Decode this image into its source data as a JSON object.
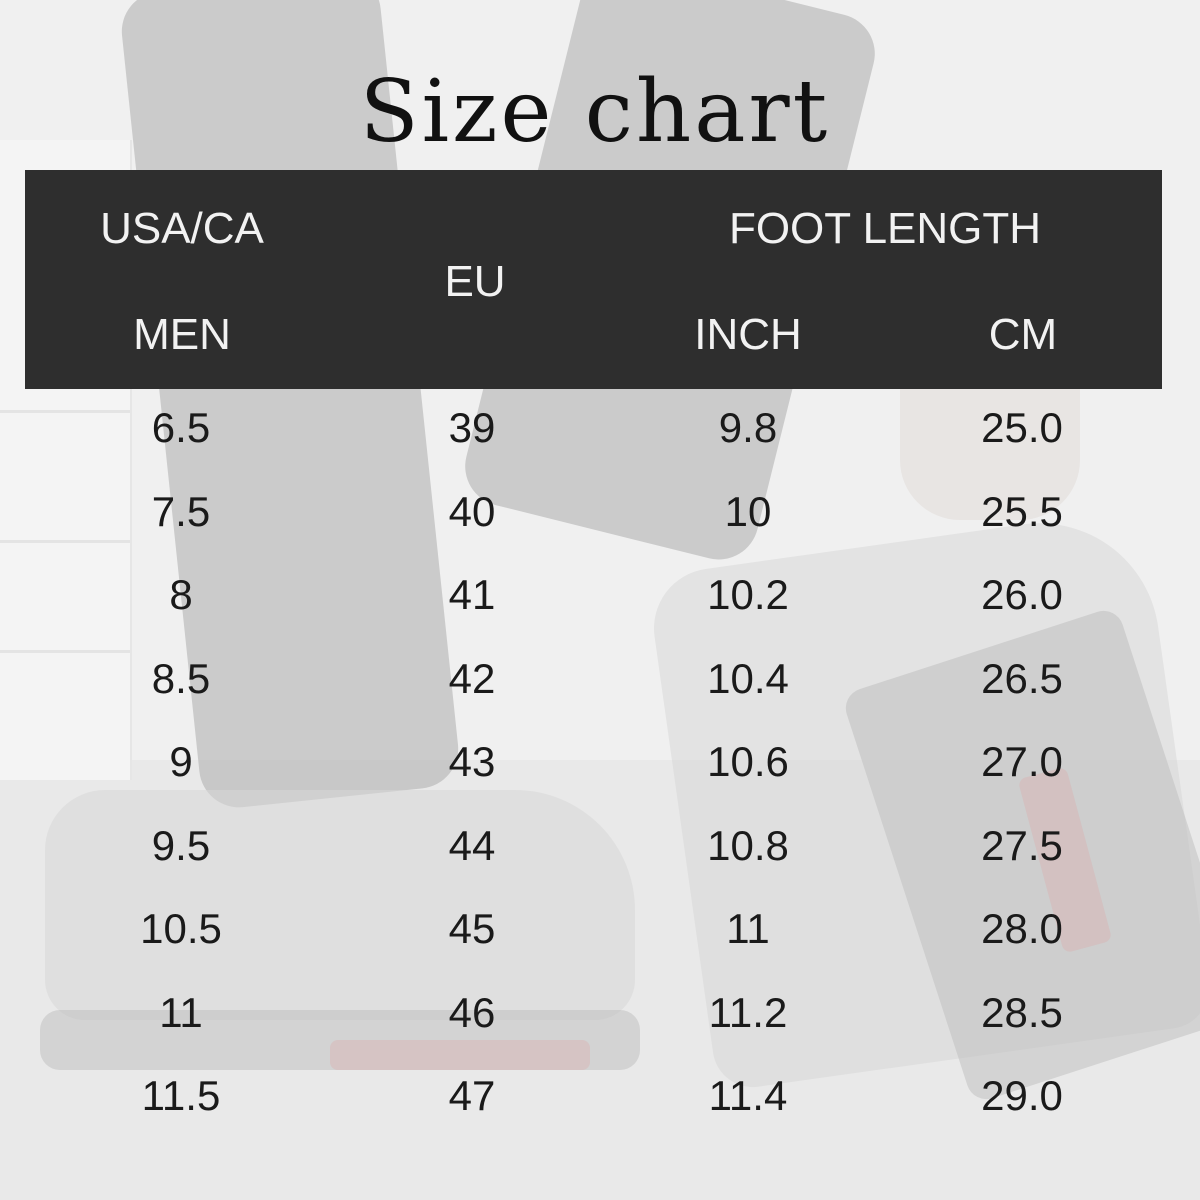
{
  "title": "Size chart",
  "header": {
    "col1_top": "USA/CA",
    "col1_bottom": "MEN",
    "col2": "EU",
    "group_label": "FOOT LENGTH",
    "col3": "INCH",
    "col4": "CM"
  },
  "rows": [
    {
      "men": "6.5",
      "eu": "39",
      "inch": "9.8",
      "cm": "25.0"
    },
    {
      "men": "7.5",
      "eu": "40",
      "inch": "10",
      "cm": "25.5"
    },
    {
      "men": "8",
      "eu": "41",
      "inch": "10.2",
      "cm": "26.0"
    },
    {
      "men": "8.5",
      "eu": "42",
      "inch": "10.4",
      "cm": "26.5"
    },
    {
      "men": "9",
      "eu": "43",
      "inch": "10.6",
      "cm": "27.0"
    },
    {
      "men": "9.5",
      "eu": "44",
      "inch": "10.8",
      "cm": "27.5"
    },
    {
      "men": "10.5",
      "eu": "45",
      "inch": "11",
      "cm": "28.0"
    },
    {
      "men": "11",
      "eu": "46",
      "inch": "11.2",
      "cm": "28.5"
    },
    {
      "men": "11.5",
      "eu": "47",
      "inch": "11.4",
      "cm": "29.0"
    }
  ],
  "colors": {
    "header_bg": "#2e2e2e",
    "header_text": "#f2f2f2",
    "body_text": "#1a1a1a"
  }
}
